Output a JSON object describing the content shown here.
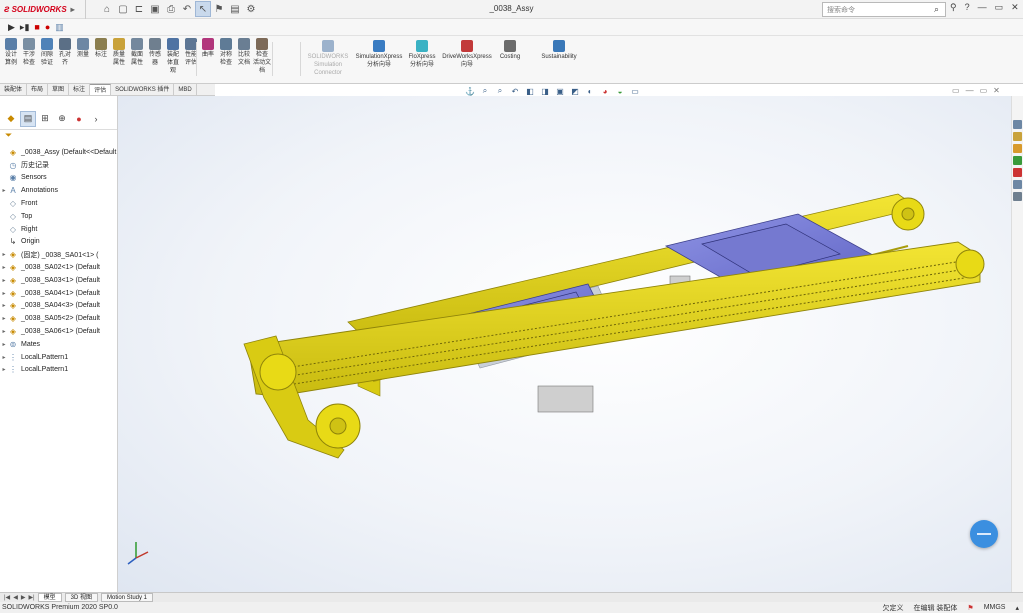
{
  "app": {
    "brand": "SOLIDWORKS",
    "window_title": "_0038_Assy",
    "search_placeholder": "搜索命令"
  },
  "ribbon": {
    "small_buttons": [
      {
        "label": "设计\n算例",
        "color": "#5a7fa8"
      },
      {
        "label": "干涉\n检查",
        "color": "#7a8fa3"
      },
      {
        "label": "间隙\n验证",
        "color": "#4f82b8"
      },
      {
        "label": "孔对\n齐",
        "color": "#5b6f86"
      },
      {
        "label": "测量",
        "color": "#6d87a4"
      },
      {
        "label": "标注",
        "color": "#8b7e4f"
      },
      {
        "label": "质量\n属性",
        "color": "#c9a23a"
      },
      {
        "label": "截面\n属性",
        "color": "#74889d"
      },
      {
        "label": "传感\n器",
        "color": "#6f7f8f"
      },
      {
        "label": "装配\n体直\n观",
        "color": "#4f73a3"
      },
      {
        "label": "性能\n评估",
        "color": "#5d7694"
      },
      {
        "label": "曲率",
        "color": "#b2367c"
      },
      {
        "label": "对称\n检查",
        "color": "#5f7b96"
      },
      {
        "label": "比较\n文档",
        "color": "#6a7e93"
      },
      {
        "label": "检查\n活动文档",
        "color": "#7d6a58"
      }
    ],
    "large_buttons": [
      {
        "label": "SOLIDWORKS\nSimulation\nConnector",
        "disabled": true,
        "color": "#9cb2cc"
      },
      {
        "label": "SimulationXpress\n分析向导",
        "disabled": false,
        "color": "#3a7cc2"
      },
      {
        "label": "FloXpress\n分析向导",
        "disabled": false,
        "color": "#3bb2c4"
      },
      {
        "label": "DriveWorksXpress\n向导",
        "disabled": false,
        "color": "#c23a3a"
      },
      {
        "label": "Costing",
        "disabled": false,
        "color": "#6c6c6c"
      },
      {
        "label": "Sustainability",
        "disabled": false,
        "color": "#3a78b8"
      }
    ]
  },
  "command_tabs": [
    "装配体",
    "布局",
    "草图",
    "标注",
    "评估",
    "SOLIDWORKS 插件",
    "MBD"
  ],
  "active_command_tab": "评估",
  "feature_tree": [
    {
      "label": "_0038_Assy  (Default<<Default",
      "icon": "assembly",
      "exp": ""
    },
    {
      "label": "历史记录",
      "icon": "history",
      "exp": ""
    },
    {
      "label": "Sensors",
      "icon": "sensor",
      "exp": ""
    },
    {
      "label": "Annotations",
      "icon": "annotation",
      "exp": "▸"
    },
    {
      "label": "Front",
      "icon": "plane",
      "exp": ""
    },
    {
      "label": "Top",
      "icon": "plane",
      "exp": ""
    },
    {
      "label": "Right",
      "icon": "plane",
      "exp": ""
    },
    {
      "label": "Origin",
      "icon": "origin",
      "exp": ""
    },
    {
      "label": "(固定) _0038_SA01<1> (",
      "icon": "subassy",
      "exp": "▸"
    },
    {
      "label": "_0038_SA02<1> (Default",
      "icon": "subassy",
      "exp": "▸"
    },
    {
      "label": "_0038_SA03<1> (Default",
      "icon": "subassy",
      "exp": "▸"
    },
    {
      "label": "_0038_SA04<1> (Default",
      "icon": "subassy",
      "exp": "▸"
    },
    {
      "label": "_0038_SA04<3> (Default",
      "icon": "subassy",
      "exp": "▸"
    },
    {
      "label": "_0038_SA05<2> (Default",
      "icon": "subassy",
      "exp": "▸"
    },
    {
      "label": "_0038_SA06<1> (Default",
      "icon": "subassy",
      "exp": "▸"
    },
    {
      "label": "Mates",
      "icon": "mates",
      "exp": "▸"
    },
    {
      "label": "LocalLPattern1",
      "icon": "pattern",
      "exp": "▸"
    },
    {
      "label": "LocalLPattern1",
      "icon": "pattern",
      "exp": "▸"
    }
  ],
  "bottom_tabs": [
    "模型",
    "3D 视图",
    "Motion Study 1"
  ],
  "status": {
    "left": "SOLIDWORKS Premium 2020 SP0.0",
    "state": "欠定义",
    "mode": "在编辑 装配体",
    "units": "MMGS"
  },
  "colors": {
    "frame_yellow": "#e8da16",
    "frame_shadow": "#b3a70d",
    "pcb_blue": "#7a7fd6",
    "accent_blue": "#3b8fe0"
  }
}
